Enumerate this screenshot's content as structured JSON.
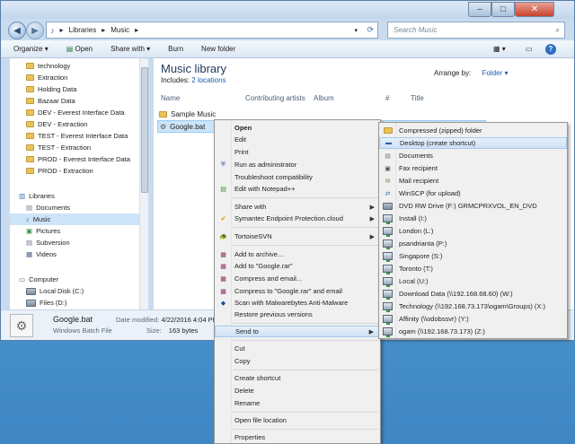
{
  "address": {
    "crumbs": [
      "Libraries",
      "Music"
    ],
    "search_placeholder": "Search Music"
  },
  "window_controls": {
    "minimize": "–",
    "maximize": "□",
    "close": "✕"
  },
  "toolbar": {
    "organize": "Organize",
    "open": "Open",
    "share_with": "Share with",
    "burn": "Burn",
    "new_folder": "New folder"
  },
  "nav": {
    "folders": [
      "technology",
      "Extraction",
      "Holding Data",
      "Bazaar Data",
      "DEV - Everest Interface Data",
      "DEV - Extraction",
      "TEST - Everest Interface Data",
      "TEST - Extraction",
      "PROD - Everest Interface Data",
      "PROD - Extraction"
    ],
    "libraries_label": "Libraries",
    "libraries": [
      "Documents",
      "Music",
      "Pictures",
      "Subversion",
      "Videos"
    ],
    "computer_label": "Computer",
    "drives": [
      "Local Disk (C:)",
      "Files (D:)"
    ]
  },
  "library": {
    "title": "Music library",
    "includes_prefix": "Includes:",
    "includes_link": "2 locations",
    "arrange_by_label": "Arrange by:",
    "arrange_by_value": "Folder"
  },
  "columns": [
    "Name",
    "Contributing artists",
    "Album",
    "#",
    "Title"
  ],
  "files": [
    "Sample Music",
    "Google.bat"
  ],
  "status": {
    "name": "Google.bat",
    "type": "Windows Batch File",
    "modified_label": "Date modified:",
    "modified_value": "4/22/2016 4:04 PM",
    "size_label": "Size:",
    "size_value": "163 bytes"
  },
  "context_menu": {
    "open": "Open",
    "edit": "Edit",
    "print": "Print",
    "run_as_admin": "Run as administrator",
    "troubleshoot": "Troubleshoot compatibility",
    "edit_notepad": "Edit with Notepad++",
    "share_with": "Share with",
    "symantec": "Symantec Endpoint Protection.cloud",
    "tortoise": "TortoiseSVN",
    "add_archive": "Add to archive...",
    "add_rar": "Add to \"Google.rar\"",
    "compress_email": "Compress and email...",
    "compress_rar_email": "Compress to \"Google.rar\" and email",
    "scan_malware": "Scan with Malwarebytes Anti-Malware",
    "restore_versions": "Restore previous versions",
    "send_to": "Send to",
    "cut": "Cut",
    "copy": "Copy",
    "create_shortcut": "Create shortcut",
    "delete": "Delete",
    "rename": "Rename",
    "open_location": "Open file location",
    "properties": "Properties"
  },
  "send_to": [
    "Compressed (zipped) folder",
    "Desktop (create shortcut)",
    "Documents",
    "Fax recipient",
    "Mail recipient",
    "WinSCP (for upload)",
    "DVD RW Drive (F:) GRMCPRXVOL_EN_DVD",
    "Install (I:)",
    "London (L:)",
    "psandrianta (P:)",
    "Singapore (S:)",
    "Toronto (T:)",
    "Local (U:)",
    "Download Data (\\\\192.168.68.60) (W:)",
    "Technology (\\\\192.168.73.173\\ogam\\Groups) (X:)",
    "Affinity (\\\\odobssvr) (Y:)",
    "ogam (\\\\192.168.73.173) (Z:)"
  ]
}
